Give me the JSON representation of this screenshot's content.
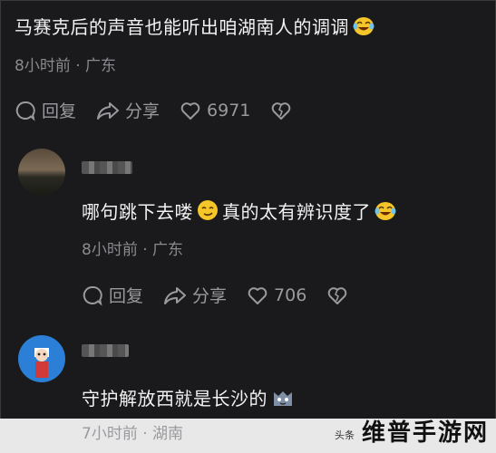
{
  "comments": [
    {
      "text_before": "马赛克后的声音也能听出咱湖南人的调调",
      "emoji": "laugh-cry-emoji",
      "meta": "8小时前 · 广东",
      "reply_label": "回复",
      "share_label": "分享",
      "like_count": "6971"
    },
    {
      "text_before": "哪句跳下去喽",
      "emoji_mid": "smirk-emoji",
      "text_after": "真的太有辨识度了",
      "emoji": "laugh-cry-emoji",
      "meta": "8小时前 · 广东",
      "reply_label": "回复",
      "share_label": "分享",
      "like_count": "706"
    },
    {
      "text_before": "守护解放西就是长沙的",
      "emoji": "cat-emoji",
      "meta": "7小时前 · 湖南"
    }
  ],
  "watermark": {
    "small": "头条",
    "big": "维普手游网"
  },
  "colors": {
    "background": "#1a1a1c",
    "text": "#f2f2f2",
    "meta": "#8a8a8e"
  }
}
